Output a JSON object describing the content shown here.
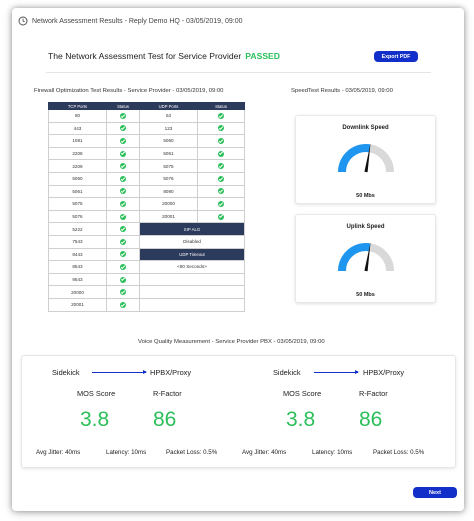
{
  "window": {
    "title": "Network Assessment Results - Reply Demo HQ - 03/05/2019, 09:00"
  },
  "header": {
    "title": "The Network Assessment Test for Service Provider",
    "status": "PASSED",
    "export_label": "Export PDF"
  },
  "firewall": {
    "section_title": "Firewall Optimization Test Results - Service Provider - 03/05/2019, 09:00",
    "tcp_header": "TCP Ports",
    "status_header": "Status",
    "udp_header": "UDP Ports",
    "tcp_ports": [
      "80",
      "443",
      "1081",
      "2208",
      "2209",
      "5060",
      "5061",
      "5075",
      "5076",
      "5222",
      "7543",
      "8443",
      "8543",
      "9543",
      "20000",
      "20001"
    ],
    "udp_ports": [
      "53",
      "123",
      "5060",
      "5061",
      "5075",
      "5076",
      "8090",
      "20000",
      "20001"
    ],
    "sip_alg_label": "SIP ALG",
    "sip_alg_value": "Disabled",
    "udp_timeout_label": "UDP Timeout",
    "udp_timeout_value": "<80 Seconds>"
  },
  "speedtest": {
    "section_title": "SpeedTest Results - 03/05/2019, 09:00",
    "downlink": {
      "title": "Downlink Speed",
      "value": "50 Mbs",
      "level": 0.55
    },
    "uplink": {
      "title": "Uplink Speed",
      "value": "50 Mbs",
      "level": 0.55
    }
  },
  "voice": {
    "section_title": "Voice Quality Measurement - Service Provider PBX - 03/05/2019, 09:00",
    "left": {
      "from": "Sidekick",
      "to": "HPBX/Proxy",
      "mos_label": "MOS Score",
      "rfactor_label": "R-Factor",
      "mos_value": "3.8",
      "rfactor_value": "86",
      "jitter": "Avg Jitter: 40ms",
      "latency": "Latency: 10ms",
      "packet_loss": "Packet Loss: 0.5%"
    },
    "right": {
      "from": "Sidekick",
      "to": "HPBX/Proxy",
      "mos_label": "MOS Score",
      "rfactor_label": "R-Factor",
      "mos_value": "3.8",
      "rfactor_value": "86",
      "jitter": "Avg Jitter: 40ms",
      "latency": "Latency: 10ms",
      "packet_loss": "Packet Loss: 0.5%"
    }
  },
  "footer": {
    "next_label": "Next"
  },
  "colors": {
    "accent": "#1230c9",
    "success": "#2bbf5a",
    "table_header": "#2c3a5c",
    "gauge_fill": "#1e96f0",
    "gauge_track": "#d9d9d9"
  },
  "icons": {
    "title_icon": "clock-icon",
    "status_icon": "check-circle-icon",
    "gauge_icon": "gauge-icon"
  }
}
